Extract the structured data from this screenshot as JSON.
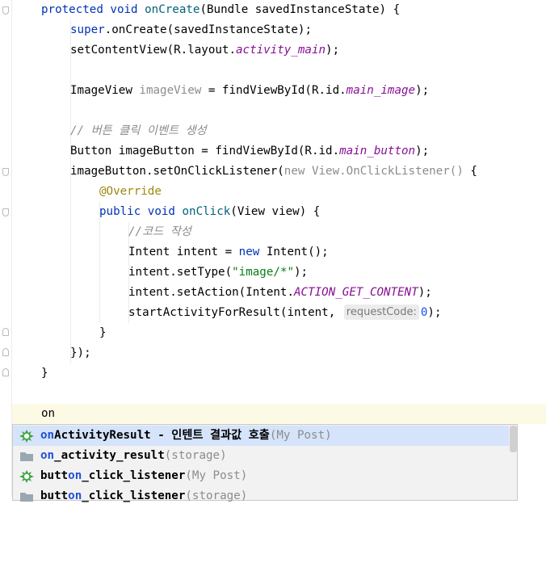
{
  "colors": {
    "keyword": "#0033b3",
    "method": "#00627a",
    "field": "#871094",
    "comment": "#8c8c8c",
    "annotation": "#9e880d",
    "string": "#067d17",
    "number": "#1750eb",
    "selection": "#d5e4fa",
    "current_line": "#fcfae4"
  },
  "code": {
    "l1": {
      "kw": "protected void ",
      "fn": "onCreate",
      "rest": "(Bundle savedInstanceState) {"
    },
    "l2": {
      "kw": "super",
      "rest1": ".",
      "fn": "onCreate",
      "rest2": "(savedInstanceState);"
    },
    "l3": {
      "pre": "setContentView(R.layout.",
      "fld": "activity_main",
      "post": ");"
    },
    "l4": {
      "pre": "ImageView ",
      "var": "imageView",
      "mid": " = findViewById(R.id.",
      "fld": "main_image",
      "post": ");"
    },
    "l5": {
      "comment": "// 버튼 클릭 이벤트 생성"
    },
    "l6": {
      "pre": "Button imageButton = findViewById(R.id.",
      "fld": "main_button",
      "post": ");"
    },
    "l7": {
      "pre": "imageButton.setOnClickListener(",
      "gray": "new View.OnClickListener()",
      "post": " {"
    },
    "l8": {
      "ann": "@Override"
    },
    "l9": {
      "kw": "public void ",
      "fn": "onClick",
      "rest": "(View view) {"
    },
    "l10": {
      "comment": "//코드 작성"
    },
    "l11": {
      "pre": "Intent intent = ",
      "kw": "new",
      "post": " Intent();"
    },
    "l12": {
      "pre": "intent.setType(",
      "str": "\"image/*\"",
      "post": ");"
    },
    "l13": {
      "pre": "intent.setAction(Intent.",
      "fld": "ACTION_GET_CONTENT",
      "post": ");"
    },
    "l14": {
      "pre": "startActivityForResult(intent, ",
      "hint": "requestCode:",
      "num": "0",
      "post": ");"
    },
    "l15": {
      "text": "}"
    },
    "l16": {
      "text": "});"
    },
    "l17": {
      "text": "}"
    },
    "l18": {
      "text": "on"
    }
  },
  "completion": {
    "items": [
      {
        "icon": "live-template-icon",
        "match": "on",
        "name": "ActivityResult - 인텐트 결과값 호출",
        "type": "(My Post)"
      },
      {
        "icon": "folder-icon",
        "match": "on",
        "name": "_activity_result",
        "type": "(storage)"
      },
      {
        "icon": "live-template-icon",
        "pre": "butt",
        "match": "on",
        "name": "_click_listener",
        "type": "(My Post)"
      },
      {
        "icon": "folder-icon",
        "pre": "butt",
        "match": "on",
        "name": "_click_listener",
        "type": "(storage)"
      }
    ]
  }
}
